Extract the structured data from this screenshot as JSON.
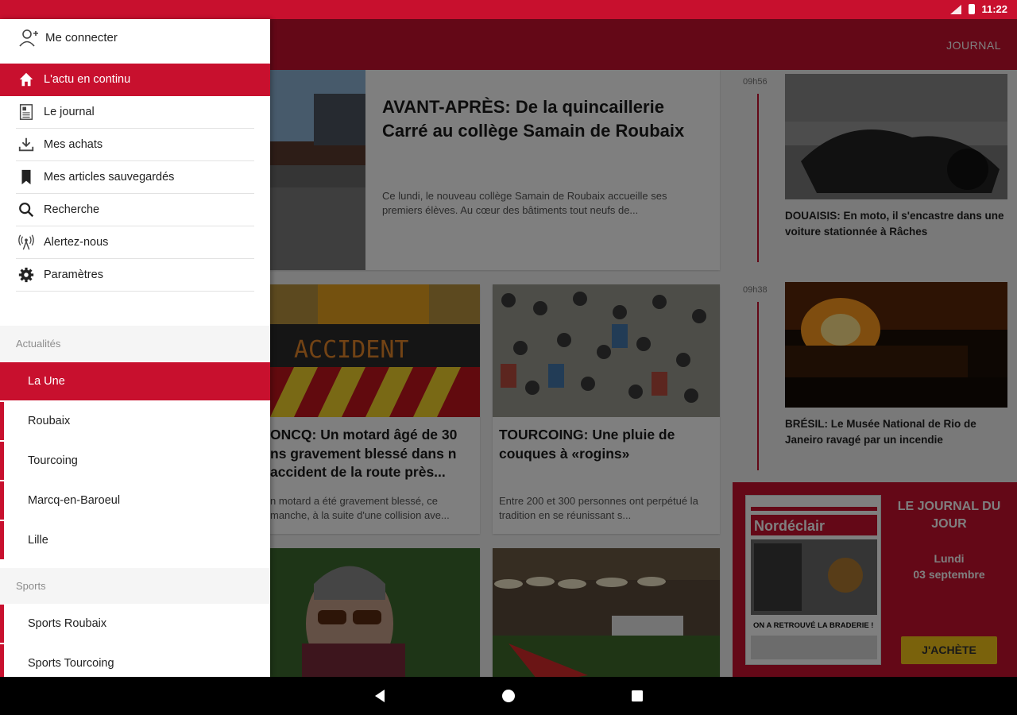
{
  "status_bar": {
    "time": "11:22"
  },
  "app_bar": {
    "action_label": "JOURNAL"
  },
  "drawer": {
    "login_label": "Me connecter",
    "menu": [
      {
        "label": "L'actu en continu",
        "icon": "home-icon",
        "active": true
      },
      {
        "label": "Le journal",
        "icon": "newspaper-icon"
      },
      {
        "label": "Mes achats",
        "icon": "download-icon"
      },
      {
        "label": "Mes articles sauvegardés",
        "icon": "bookmark-icon"
      },
      {
        "label": "Recherche",
        "icon": "search-icon"
      },
      {
        "label": "Alertez-nous",
        "icon": "broadcast-icon"
      },
      {
        "label": "Paramètres",
        "icon": "gear-icon"
      }
    ],
    "sections": [
      {
        "title": "Actualités",
        "items": [
          {
            "label": "La Une",
            "active": true
          },
          {
            "label": "Roubaix"
          },
          {
            "label": "Tourcoing"
          },
          {
            "label": "Marcq-en-Baroeul"
          },
          {
            "label": "Lille"
          }
        ]
      },
      {
        "title": "Sports",
        "items": [
          {
            "label": "Sports Roubaix"
          },
          {
            "label": "Sports Tourcoing"
          }
        ]
      }
    ]
  },
  "articles": {
    "featured": {
      "title": "AVANT-APRÈS: De la quincaillerie Carré au collège Samain de Roubaix",
      "excerpt": "Ce lundi, le nouveau collège Samain de Roubaix accueille ses premiers élèves. Au cœur des bâtiments tout neufs de..."
    },
    "card_left": {
      "image_text": "ACCIDENT",
      "title": "ONCQ: Un motard âgé de 30 ns gravement blessé dans n accident de la route près...",
      "excerpt": "n motard a été gravement blessé, ce manche, à la suite d'une collision ave..."
    },
    "card_right": {
      "title": "TOURCOING: Une pluie de couques à «rogins»",
      "excerpt": "Entre 200 et 300 personnes ont perpétué la tradition en se réunissant s..."
    }
  },
  "live": [
    {
      "time": "09h56",
      "title": "DOUAISIS: En moto, il s'encastre dans une voiture stationnée à Râches"
    },
    {
      "time": "09h38",
      "title": "BRÉSIL: Le Musée National de Rio de Janeiro ravagé par un incendie"
    }
  ],
  "journal": {
    "heading": "LE JOURNAL DU JOUR",
    "day": "Lundi",
    "date": "03 septembre",
    "masthead": "Nordéclair",
    "cover_headline": "ON A RETROUVÉ LA BRADERIE !",
    "buy_label": "J'ACHÈTE"
  },
  "colors": {
    "brand_red": "#c8102e",
    "buy_yellow": "#f5c518"
  }
}
